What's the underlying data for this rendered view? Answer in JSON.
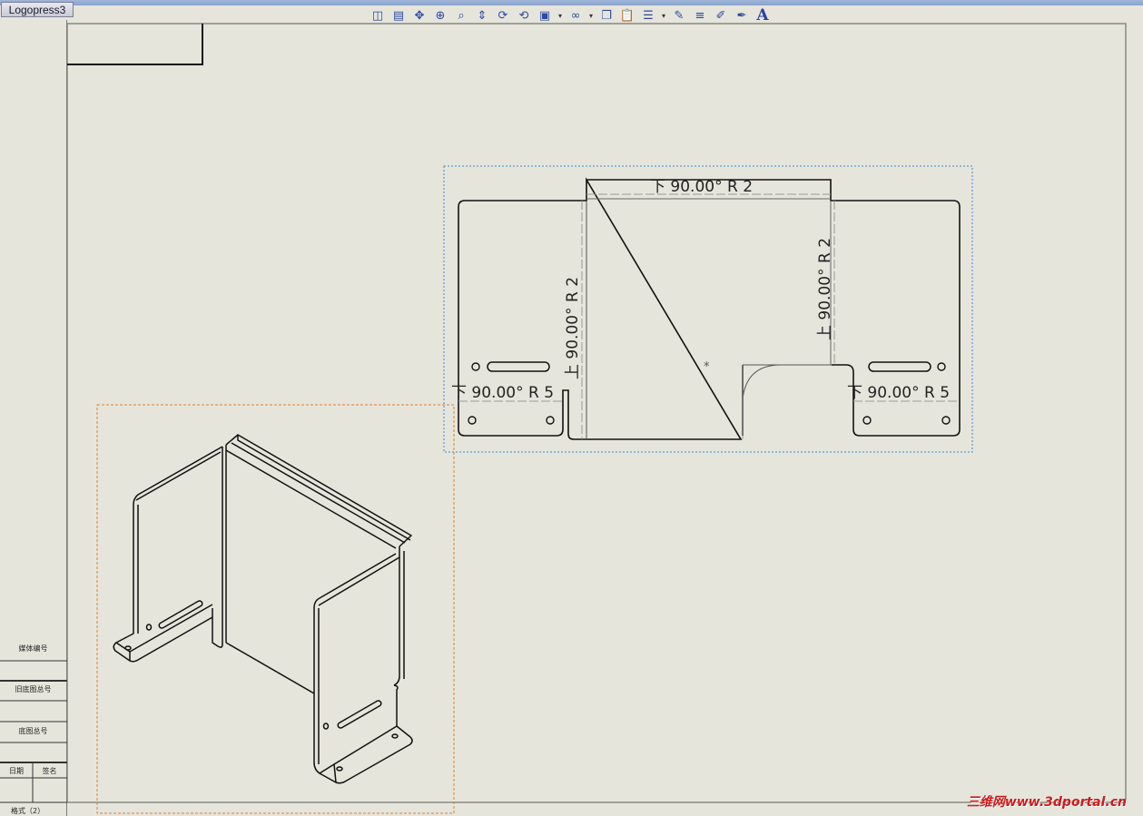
{
  "window": {
    "doc_tab_label": "Logopress3"
  },
  "toolbar": {
    "icons": [
      "split-view-icon",
      "tile-view-icon",
      "pan-icon",
      "zoom-to-fit-icon",
      "zoom-area-icon",
      "zoom-in-out-icon",
      "rotate-icon",
      "rotate-view-icon",
      "view-orientation-icon",
      "display-style-icon",
      "copy-icon",
      "paste-icon",
      "line-format-icon",
      "line-style-icon",
      "line-thickness-icon",
      "annotation-icon",
      "pen-icon",
      "text-font-icon"
    ],
    "text_font_glyph": "A"
  },
  "title_block": {
    "media_no": "媒体编号",
    "old_drawing_no": "旧底图总号",
    "drawing_no": "底图总号",
    "date": "日期",
    "signature": "签名",
    "format": "格式（2）"
  },
  "flat_pattern": {
    "top_bend_note": "下 90.00° R 2",
    "left_vertical_bend_note": "上 90.00° R 2",
    "right_vertical_bend_note": "上 90.00° R 2",
    "left_bottom_bend_note": "下 90.00° R 5",
    "right_bottom_bend_note": "下 90.00° R 5",
    "center_mark": "*"
  },
  "watermark": "三维网www.3dportal.cn",
  "colors": {
    "background": "#e6e5dc",
    "selection_blue": "#3a8ad0",
    "selection_orange": "#e0802a",
    "line": "#111111",
    "watermark": "#d21a1a"
  }
}
